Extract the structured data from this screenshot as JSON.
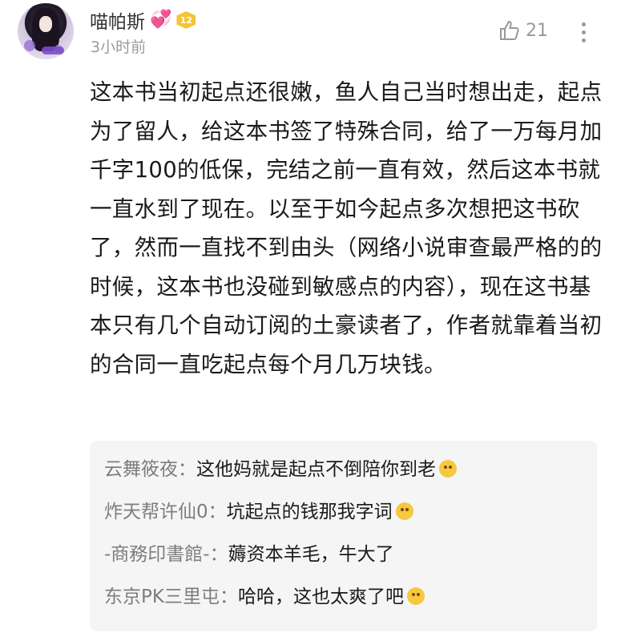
{
  "post": {
    "username": "喵帕斯",
    "level": "12",
    "time": "3小时前",
    "likes": "21",
    "content": "这本书当初起点还很嫩，鱼人自己当时想出走，起点为了留人，给这本书签了特殊合同，给了一万每月加千字100的低保，完结之前一直有效，然后这本书就一直水到了现在。以至于如今起点多次想把这书砍了，然而一直找不到由头（网络小说审查最严格的的时候，这本书也没碰到敏感点的内容），现在这书基本只有几个自动订阅的土豪读者了，作者就靠着当初的合同一直吃起点每个月几万块钱。"
  },
  "replies": [
    {
      "name": "云舞筱夜：",
      "text": "这他妈就是起点不倒陪你到老",
      "emoji": "thinking-emoji"
    },
    {
      "name": "炸天帮许仙0：",
      "text": "坑起点的钱那我字词",
      "emoji": "surprised-emoji"
    },
    {
      "name": "-商務印書館-：",
      "text": "薅资本羊毛，牛大了",
      "emoji": ""
    },
    {
      "name": "东京PK三里屯：",
      "text": "哈哈，这也太爽了吧",
      "emoji": "surprised-emoji"
    }
  ],
  "colors": {
    "name": "#333333",
    "time": "#9a9a9a",
    "reply_name": "#7d7d7d",
    "reply_bg": "#f5f5f5",
    "badge": "#f5c437"
  }
}
